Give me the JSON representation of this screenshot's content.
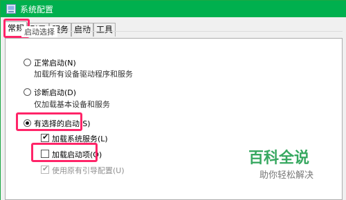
{
  "window": {
    "title": "系统配置"
  },
  "tabs": [
    {
      "label": "常规",
      "active": true
    },
    {
      "label": "引导",
      "active": false
    },
    {
      "label": "服务",
      "active": false
    },
    {
      "label": "启动",
      "active": false
    },
    {
      "label": "工具",
      "active": false
    }
  ],
  "startup_group": {
    "title": "启动选择",
    "options": [
      {
        "label": "正常启动(N)",
        "desc": "加载所有设备驱动程序和服务",
        "selected": false
      },
      {
        "label": "诊断启动(D)",
        "desc": "仅加载基本设备和服务",
        "selected": false
      },
      {
        "label": "有选择的启动(S)",
        "desc": "",
        "selected": true
      }
    ],
    "checkboxes": [
      {
        "label": "加载系统服务(L)",
        "checked": true,
        "disabled": false
      },
      {
        "label": "加载启动项(O)",
        "checked": false,
        "disabled": false
      },
      {
        "label": "使用原有引导配置(U)",
        "checked": true,
        "disabled": true
      }
    ]
  },
  "watermark": {
    "title": "百科全说",
    "subtitle": "助你轻松解决"
  },
  "colors": {
    "titlebar": "#00b04e",
    "highlight": "#ff2468",
    "watermark": "#37a860"
  }
}
